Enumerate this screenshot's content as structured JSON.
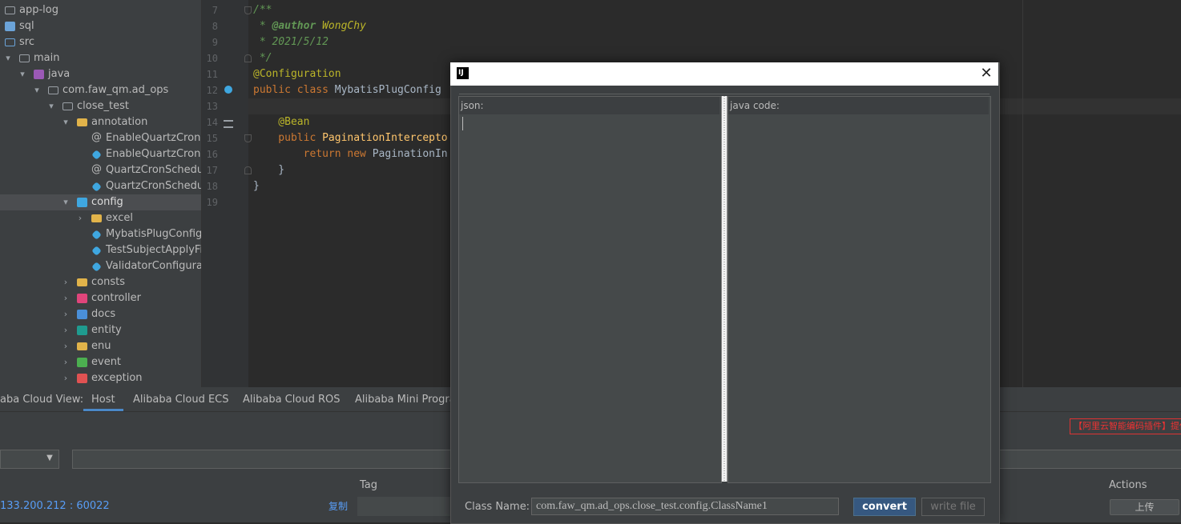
{
  "project_tree": [
    {
      "label": "app-log",
      "icon": "folder-icon",
      "arrow": ""
    },
    {
      "label": "sql",
      "icon": "source-folder-icon",
      "arrow": ""
    },
    {
      "label": "src",
      "icon": "source-folder-icon",
      "arrow": ""
    },
    {
      "label": "main",
      "icon": "folder-icon",
      "arrow": "▾"
    },
    {
      "label": "java",
      "icon": "source-root-icon",
      "arrow": "▾"
    },
    {
      "label": "com.faw_qm.ad_ops",
      "icon": "package-icon",
      "arrow": "▾"
    },
    {
      "label": "close_test",
      "icon": "package-icon",
      "arrow": "▾"
    },
    {
      "label": "annotation",
      "icon": "folder-icon",
      "arrow": "▾"
    },
    {
      "label": "EnableQuartzCronS",
      "icon": "annotation-icon",
      "arrow": ""
    },
    {
      "label": "EnableQuartzCronS",
      "icon": "class-icon",
      "arrow": ""
    },
    {
      "label": "QuartzCronSchedu",
      "icon": "annotation-icon",
      "arrow": ""
    },
    {
      "label": "QuartzCronSchedu",
      "icon": "class-icon",
      "arrow": ""
    },
    {
      "label": "config",
      "icon": "config-folder-icon",
      "arrow": "▾"
    },
    {
      "label": "excel",
      "icon": "folder-icon",
      "arrow": "›"
    },
    {
      "label": "MybatisPlugConfig",
      "icon": "class-icon",
      "arrow": ""
    },
    {
      "label": "TestSubjectApplyFil",
      "icon": "class-icon",
      "arrow": ""
    },
    {
      "label": "ValidatorConfigurat",
      "icon": "class-icon",
      "arrow": ""
    },
    {
      "label": "consts",
      "icon": "folder-icon",
      "arrow": "›"
    },
    {
      "label": "controller",
      "icon": "controller-folder-icon",
      "arrow": "›"
    },
    {
      "label": "docs",
      "icon": "docs-folder-icon",
      "arrow": "›"
    },
    {
      "label": "entity",
      "icon": "entity-folder-icon",
      "arrow": "›"
    },
    {
      "label": "enu",
      "icon": "folder-icon",
      "arrow": "›"
    },
    {
      "label": "event",
      "icon": "event-folder-icon",
      "arrow": "›"
    },
    {
      "label": "exception",
      "icon": "exception-folder-icon",
      "arrow": "›"
    }
  ],
  "line_numbers": [
    "7",
    "8",
    "9",
    "10",
    "11",
    "12",
    "13",
    "14",
    "15",
    "16",
    "17",
    "18",
    "19"
  ],
  "code": {
    "l7": "/**",
    "l8a": " * ",
    "l8b": "@author",
    "l8c": " WongChy",
    "l9": " * 2021/5/12",
    "l10": " */",
    "l11": "@Configuration",
    "l12a": "public class ",
    "l12b": "MybatisPlugConfig",
    "l14": "    @Bean",
    "l15a": "    public ",
    "l15b": "PaginationIntercepto",
    "l16a": "        return new ",
    "l16b": "PaginationIn",
    "l17": "    }",
    "l18": "}"
  },
  "bottom_panel": {
    "title": "aba Cloud View:",
    "tabs": [
      "Host",
      "Alibaba Cloud ECS",
      "Alibaba Cloud ROS",
      "Alibaba Mini Progra"
    ],
    "active_tab": "Host",
    "promo": "【阿里云智能编码插件】提供",
    "columns": {
      "tag": "Tag",
      "actions": "Actions"
    },
    "row": {
      "host": "133.200.212 : 60022",
      "copy": "复制",
      "upload": "上传"
    }
  },
  "dialog": {
    "logo": "IJ",
    "close": "✕",
    "json_label": "json:",
    "java_label": "java code:",
    "class_name_label": "Class Name:",
    "class_name_value": "com.faw_qm.ad_ops.close_test.config.ClassName1",
    "convert_label": "convert",
    "write_file_label": "write file"
  },
  "colors": {
    "accent": "#4a88c7",
    "button_primary": "#365880",
    "link": "#589df6",
    "promo": "#e33333"
  }
}
